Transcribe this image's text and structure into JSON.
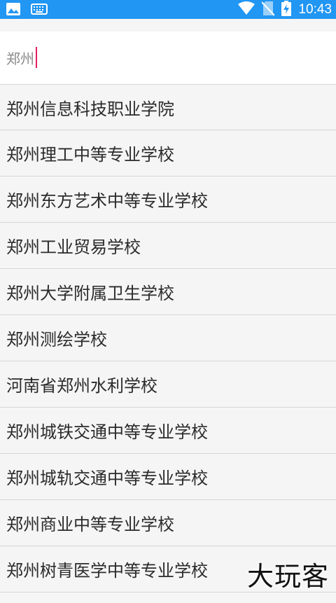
{
  "status_bar": {
    "time": "10:43",
    "icons": [
      "image-icon",
      "keyboard-icon",
      "wifi-icon",
      "no-sim-icon",
      "battery-charging-icon"
    ]
  },
  "search": {
    "value": "郑州"
  },
  "results": [
    "郑州信息科技职业学院",
    "郑州理工中等专业学校",
    "郑州东方艺术中等专业学校",
    "郑州工业贸易学校",
    "郑州大学附属卫生学校",
    "郑州测绘学校",
    "河南省郑州水利学校",
    "郑州城铁交通中等专业学校",
    "郑州城轨交通中等专业学校",
    "郑州商业中等专业学校",
    "郑州树青医学中等专业学校"
  ],
  "watermark": "大玩客",
  "colors": {
    "status_bar": "#2196f3",
    "caret": "#e91e63",
    "list_background": "#f5f5f5",
    "divider": "#d6d6d6"
  }
}
